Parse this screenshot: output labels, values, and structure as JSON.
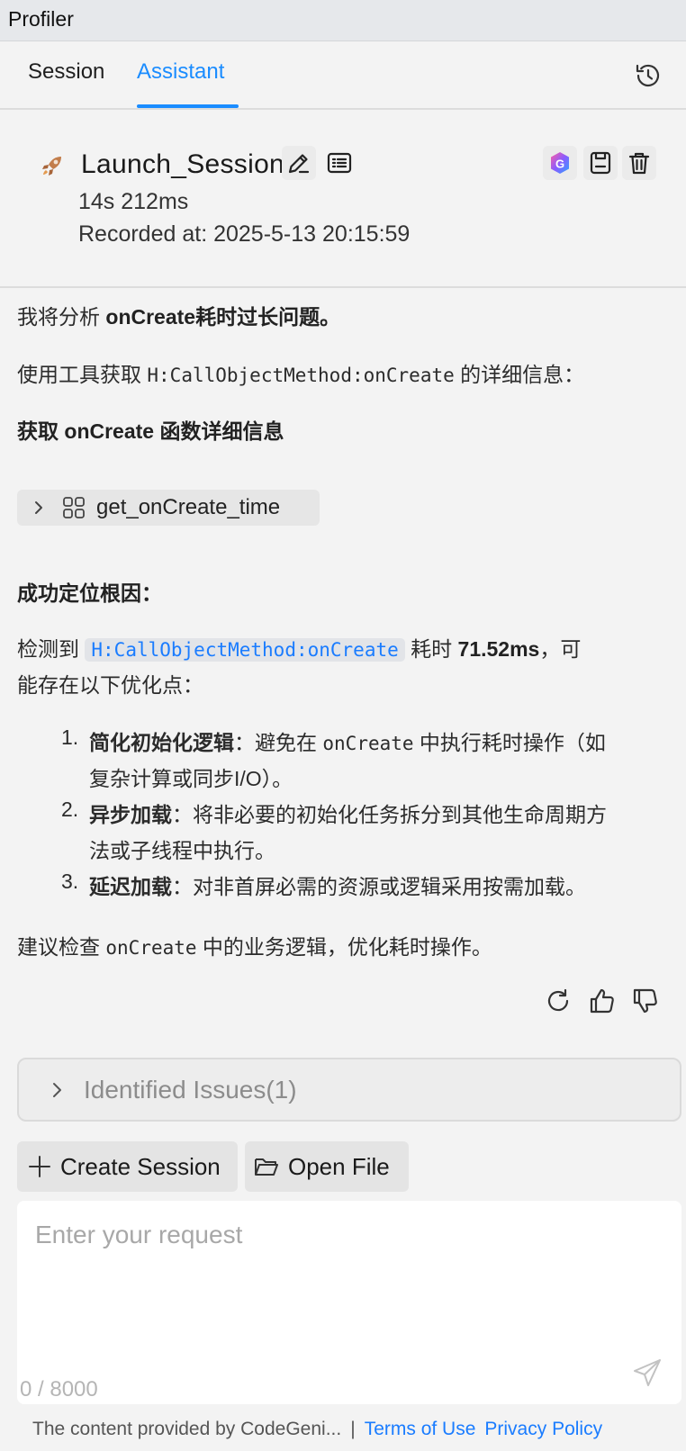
{
  "window": {
    "title": "Profiler"
  },
  "tabs": [
    {
      "label": "Session",
      "active": false
    },
    {
      "label": "Assistant",
      "active": true
    }
  ],
  "session": {
    "name": "Launch_Session",
    "duration": "14s 212ms",
    "recorded_at": "Recorded at: 2025-5-13 20:15:59"
  },
  "message": {
    "intro_prefix": "我将分析 ",
    "intro_bold": "onCreate耗时过长问题。",
    "tool_prefix": "使用工具获取 ",
    "tool_code": "H:CallObjectMethod:onCreate",
    "tool_suffix": " 的详细信息：",
    "step_heading": "获取 onCreate 函数详细信息",
    "tool_call_label": "get_onCreate_time",
    "root_cause_heading": "成功定位根因：",
    "detect_prefix": "检测到 ",
    "detect_code": "H:CallObjectMethod:onCreate",
    "detect_mid": " 耗时 ",
    "detect_value": "71.52ms",
    "detect_suffix": "，可",
    "detect_line2": "能存在以下优化点：",
    "items": [
      {
        "num": "1.",
        "title": "简化初始化逻辑",
        "text_a": "：避免在 ",
        "code": "onCreate",
        "text_b": " 中执行耗时操作（如",
        "line2": "复杂计算或同步I/O）。"
      },
      {
        "num": "2.",
        "title": "异步加载",
        "text_a": "：将非必要的初始化任务拆分到其他生命周期方",
        "line2": "法或子线程中执行。"
      },
      {
        "num": "3.",
        "title": "延迟加载",
        "text_a": "：对非首屏必需的资源或逻辑采用按需加载。"
      }
    ],
    "advice_prefix": "建议检查 ",
    "advice_code": "onCreate",
    "advice_suffix": " 中的业务逻辑，优化耗时操作。"
  },
  "issues": {
    "label": "Identified Issues(1)"
  },
  "actions": {
    "create_session": "Create Session",
    "open_file": "Open File"
  },
  "input": {
    "placeholder": "Enter your request",
    "value": "",
    "counter": "0 / 8000"
  },
  "footer": {
    "disclaimer": "The content provided by CodeGeni...",
    "separator": "|",
    "terms": "Terms of Use",
    "privacy": "Privacy Policy"
  },
  "colors": {
    "accent": "#1a8cff",
    "link": "#1a7cff",
    "background": "#f3f3f3"
  }
}
